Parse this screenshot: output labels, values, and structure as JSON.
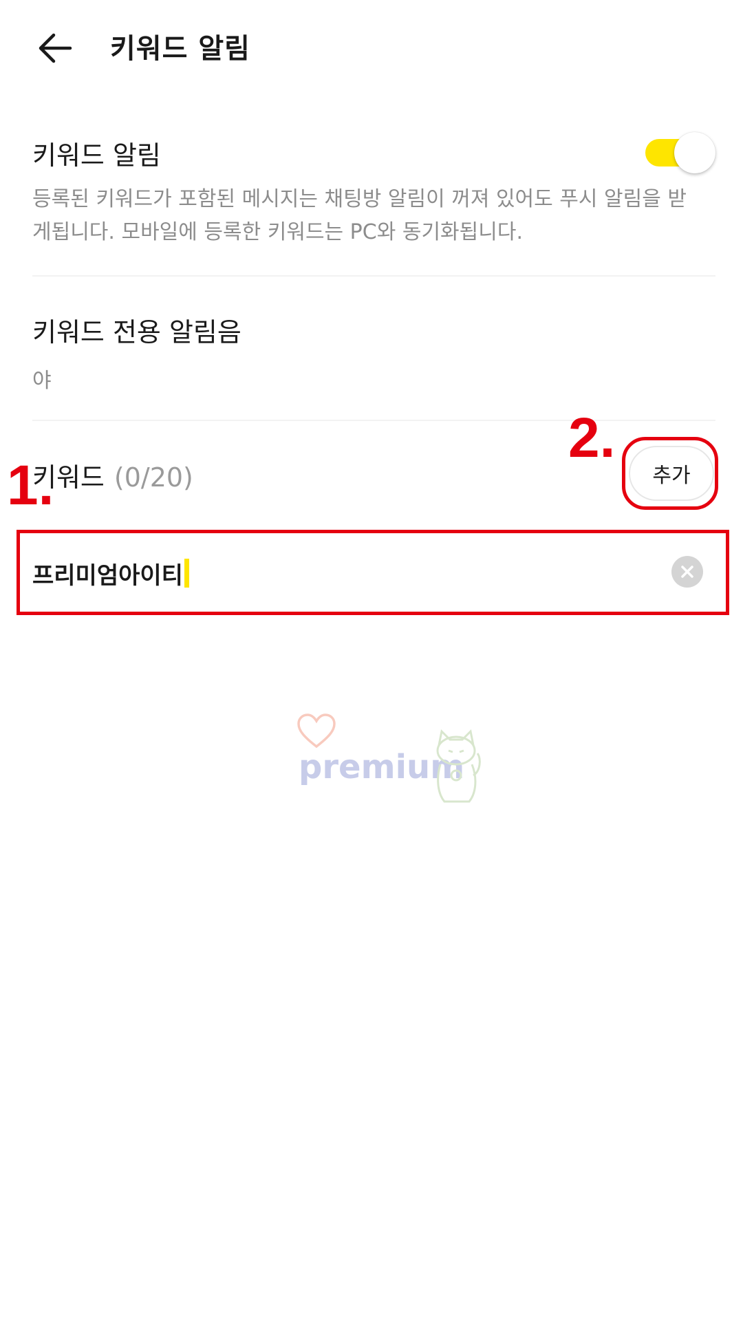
{
  "header": {
    "title": "키워드 알림"
  },
  "keyword_alert": {
    "title": "키워드 알림",
    "enabled": true,
    "description": "등록된 키워드가 포함된 메시지는 채팅방 알림이 꺼져 있어도 푸시 알림을 받게됩니다. 모바일에 등록한 키워드는 PC와 동기화됩니다."
  },
  "sound": {
    "title": "키워드 전용 알림음",
    "value": "야"
  },
  "keywords": {
    "title": "키워드",
    "count": "(0/20)",
    "add_label": "추가",
    "input_value": "프리미엄아이티"
  },
  "annotations": {
    "step1": "1.",
    "step2": "2."
  },
  "watermark": {
    "text": "premium"
  },
  "colors": {
    "accent_yellow": "#fee500",
    "annotation_red": "#e5000f"
  }
}
